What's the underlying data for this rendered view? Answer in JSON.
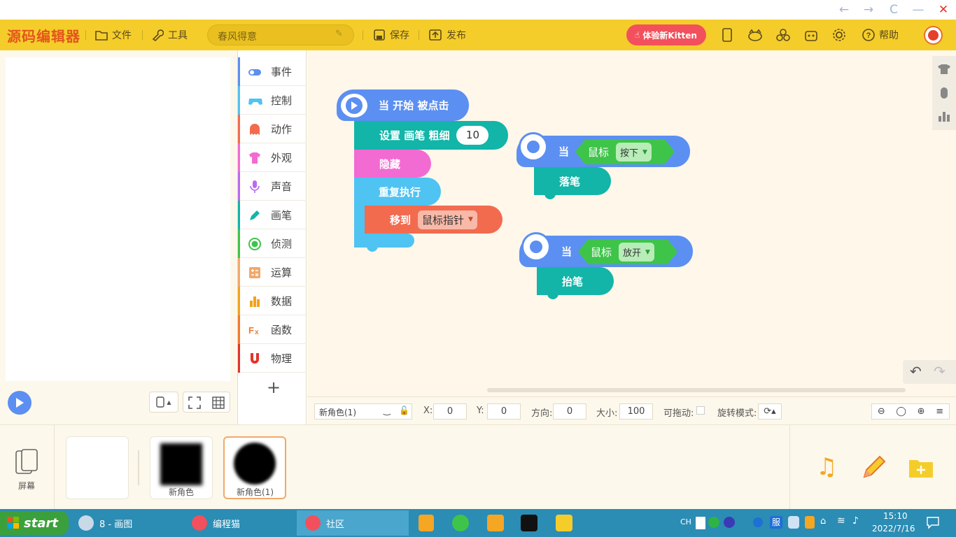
{
  "window": {
    "back": "←",
    "forward": "→",
    "refresh": "C",
    "minimize": "—",
    "close": "✕"
  },
  "topbar": {
    "logo": "源码编辑器",
    "file": "文件",
    "tools": "工具",
    "project_name": "春风得意",
    "save": "保存",
    "publish": "发布",
    "try_kitten": "体验新Kitten",
    "help": "帮助"
  },
  "categories": [
    {
      "label": "事件",
      "color": "#5c8ff2"
    },
    {
      "label": "控制",
      "color": "#4fc3f2"
    },
    {
      "label": "动作",
      "color": "#f26b4f"
    },
    {
      "label": "外观",
      "color": "#f26bd2"
    },
    {
      "label": "声音",
      "color": "#b96bf2"
    },
    {
      "label": "画笔",
      "color": "#12b5a8"
    },
    {
      "label": "侦测",
      "color": "#3fc44a"
    },
    {
      "label": "运算",
      "color": "#f2a86b"
    },
    {
      "label": "数据",
      "color": "#f2a31a"
    },
    {
      "label": "函数",
      "color": "#f27a2b"
    },
    {
      "label": "物理",
      "color": "#e2342b"
    }
  ],
  "add_category": "+",
  "blocks": {
    "start": "当 开始 被点击",
    "set_pen": "设置 画笔 粗细",
    "set_pen_value": "10",
    "hide": "隐藏",
    "repeat": "重复执行",
    "move_to": "移到",
    "move_target": "鼠标指针",
    "when1": "当",
    "mouse1": "鼠标",
    "press": "按下",
    "pen_down": "落笔",
    "when2": "当",
    "mouse2": "鼠标",
    "release": "放开",
    "pen_up": "抬笔"
  },
  "props": {
    "sprite_name": "新角色(1)",
    "x_label": "X:",
    "x": "0",
    "y_label": "Y:",
    "y": "0",
    "dir_label": "方向:",
    "dir": "0",
    "size_label": "大小:",
    "size": "100",
    "drag_label": "可拖动:",
    "rotate_label": "旋转模式:"
  },
  "bottom": {
    "screen": "屏幕",
    "sprite1": "新角色",
    "sprite2": "新角色(1)"
  },
  "taskbar": {
    "start": "start",
    "app1": "8 - 画图",
    "app2": "编程猫",
    "app3": "社区",
    "lang": "CH",
    "tray_fu": "服",
    "time": "15:10",
    "date": "2022/7/16"
  },
  "colors": {
    "topbar": "#f5cd2b",
    "event": "#5c8ff2",
    "pen": "#12b5a8",
    "look": "#f26bd2",
    "control": "#4fc3f2",
    "motion": "#f26b4f",
    "sense": "#3fc44a",
    "kitten": "#f2505c"
  }
}
